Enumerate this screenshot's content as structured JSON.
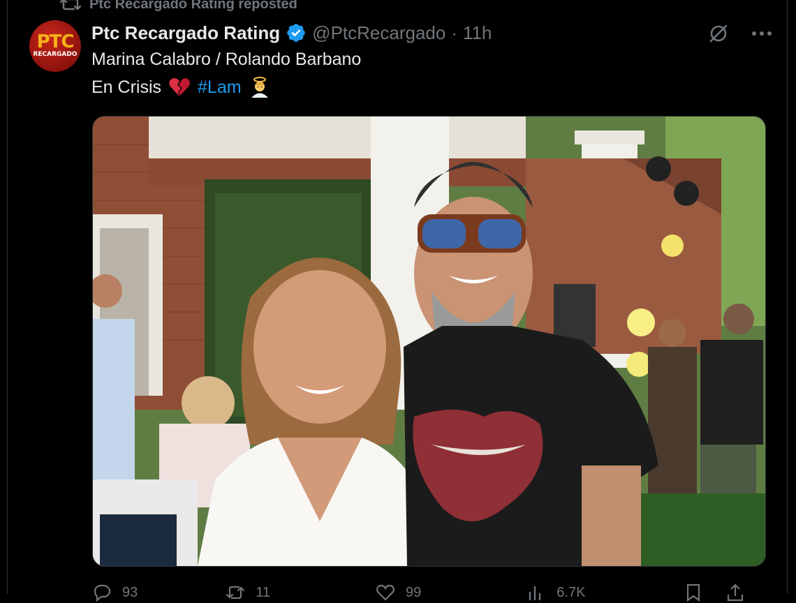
{
  "repost": {
    "text": "Ptc Recargado Rating reposted"
  },
  "author": {
    "avatar_title": "PTC",
    "avatar_subtitle": "RECARGADO",
    "name": "Ptc Recargado Rating",
    "handle": "@PtcRecargado",
    "separator": "·",
    "time": "11h"
  },
  "post": {
    "line1": "Marina Calabro / Rolando Barbano",
    "line2_text": "En Crisis",
    "hashtag": "#Lam"
  },
  "actions": {
    "replies": "93",
    "reposts": "11",
    "likes": "99",
    "views": "6.7K"
  },
  "colors": {
    "background": "#000000",
    "text": "#e7e9ea",
    "muted": "#71767b",
    "accent": "#1d9bf0",
    "avatar_red": "#c8261c",
    "avatar_gold": "#f6b21a"
  }
}
